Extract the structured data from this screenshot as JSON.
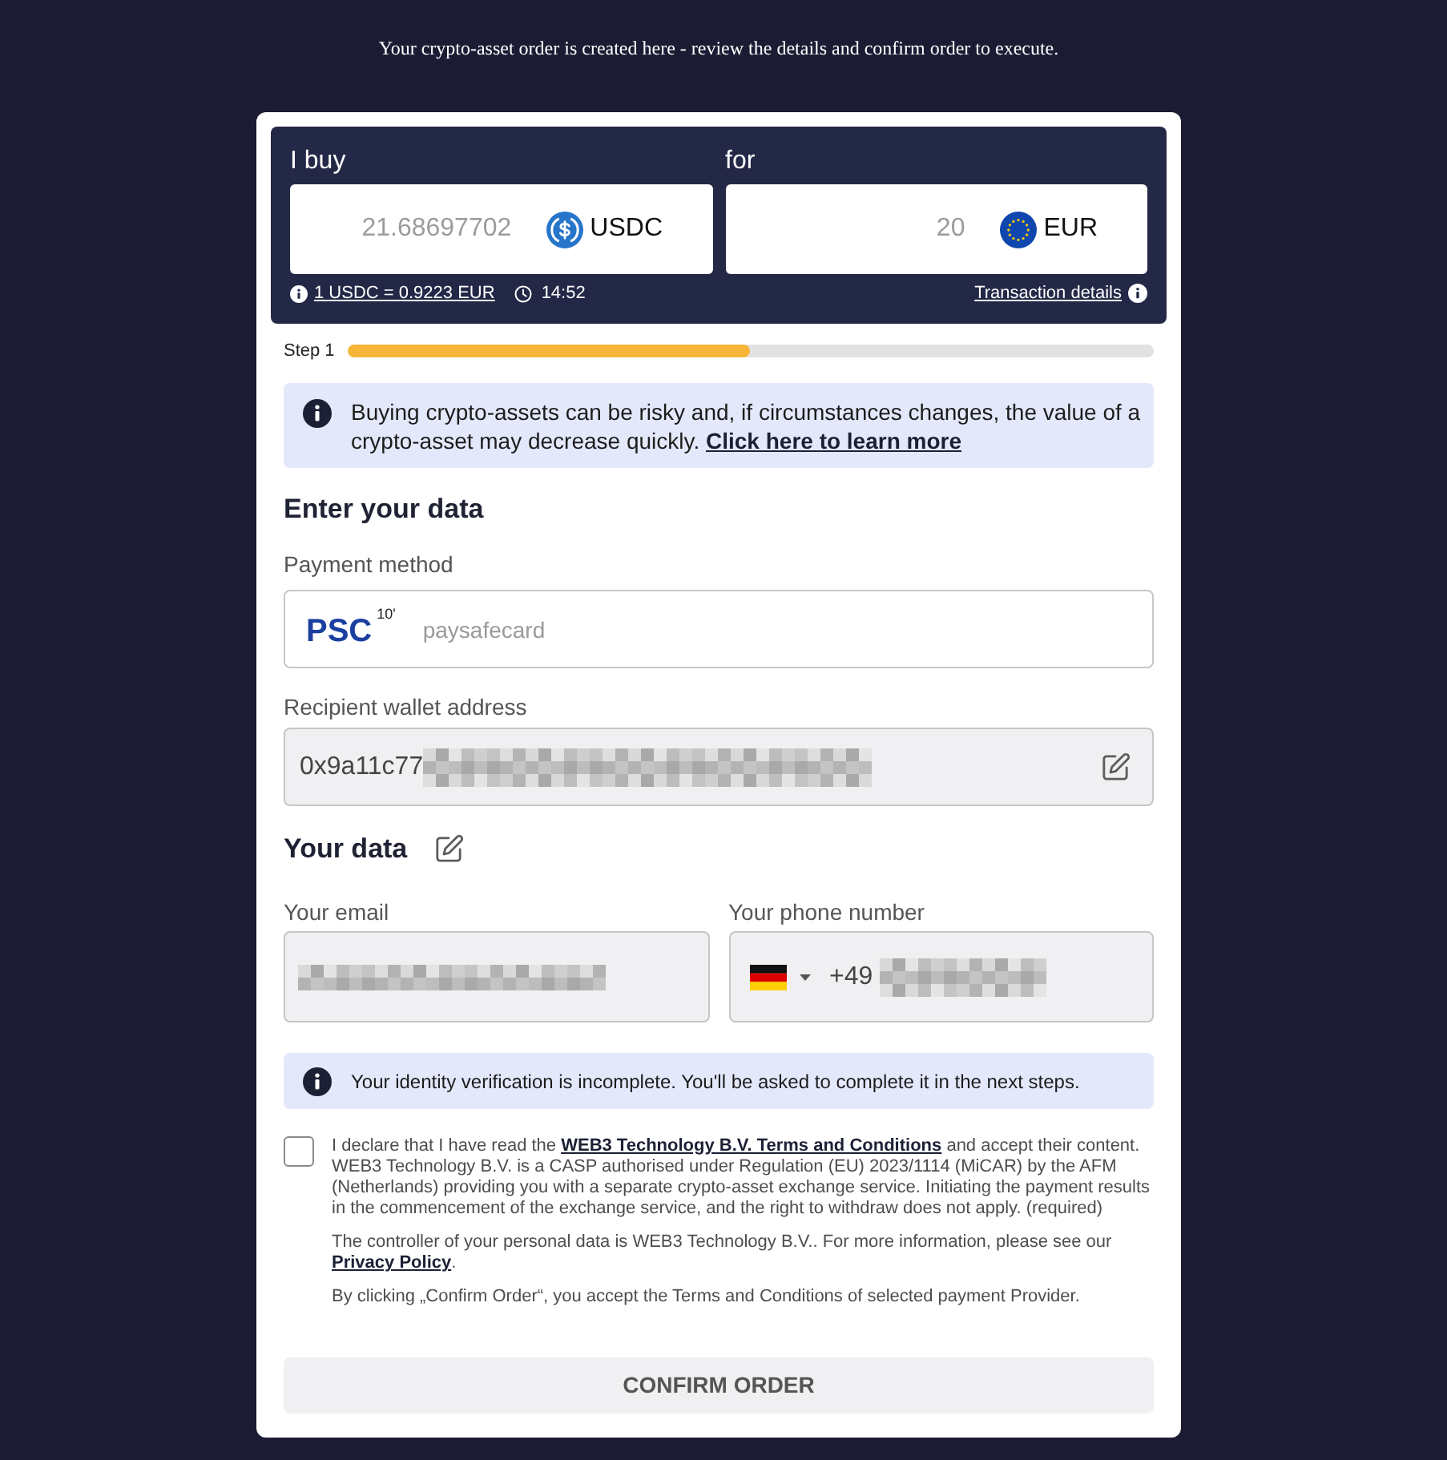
{
  "banner": {
    "text": "Your crypto-asset order is created here - review the details and confirm order to execute."
  },
  "order": {
    "buy": {
      "label": "I buy",
      "amount": "21.68697702",
      "currency": "USDC",
      "kind": "stablecoin"
    },
    "pay": {
      "label": "for",
      "amount": "20",
      "currency": "EUR",
      "kind": "euro"
    },
    "rate": "1 USDC = 0.9223 EUR",
    "timer": "14:52",
    "details_link": "Transaction details"
  },
  "progress": {
    "label": "Step 1",
    "level": 0.5
  },
  "risk_notice": {
    "text": "Buying crypto-assets can be risky and, if circumstances changes, the value of a crypto-asset may decrease quickly.",
    "link": "Click here to learn more"
  },
  "form": {
    "title": "Enter your data",
    "payment_method": {
      "label": "Payment method",
      "logo": "PSC",
      "logo_mark": "10'",
      "name": "paysafecard"
    },
    "wallet": {
      "label": "Recipient wallet address",
      "value": "0x9a11c77"
    },
    "your_data": {
      "title": "Your data"
    },
    "email": {
      "label": "Your email"
    },
    "phone": {
      "label": "Your phone number",
      "country_code": "+49"
    }
  },
  "identity_notice": {
    "text": "Your identity verification is incomplete. You'll be asked to complete it in the next steps."
  },
  "consent": {
    "checked": false,
    "declaration": {
      "before": "I declare that I have read the ",
      "link": "WEB3 Technology B.V. Terms and Conditions",
      "after": " and accept their content. WEB3 Technology B.V. is a CASP authorised under Regulation (EU) 2023/1114 (MiCAR) by the AFM (Netherlands) providing you with a separate crypto-asset exchange service. Initiating the payment results in the commencement of the exchange service, and the right to withdraw does not apply. (required)"
    },
    "privacy": {
      "before": "The controller of your personal data is WEB3 Technology B.V.. For more information, please see our ",
      "link": "Privacy Policy",
      "after": "."
    },
    "provider_note": "By clicking „Confirm Order“, you accept the Terms and Conditions of selected payment Provider."
  },
  "button": {
    "label": "CONFIRM ORDER",
    "disabled": true
  }
}
